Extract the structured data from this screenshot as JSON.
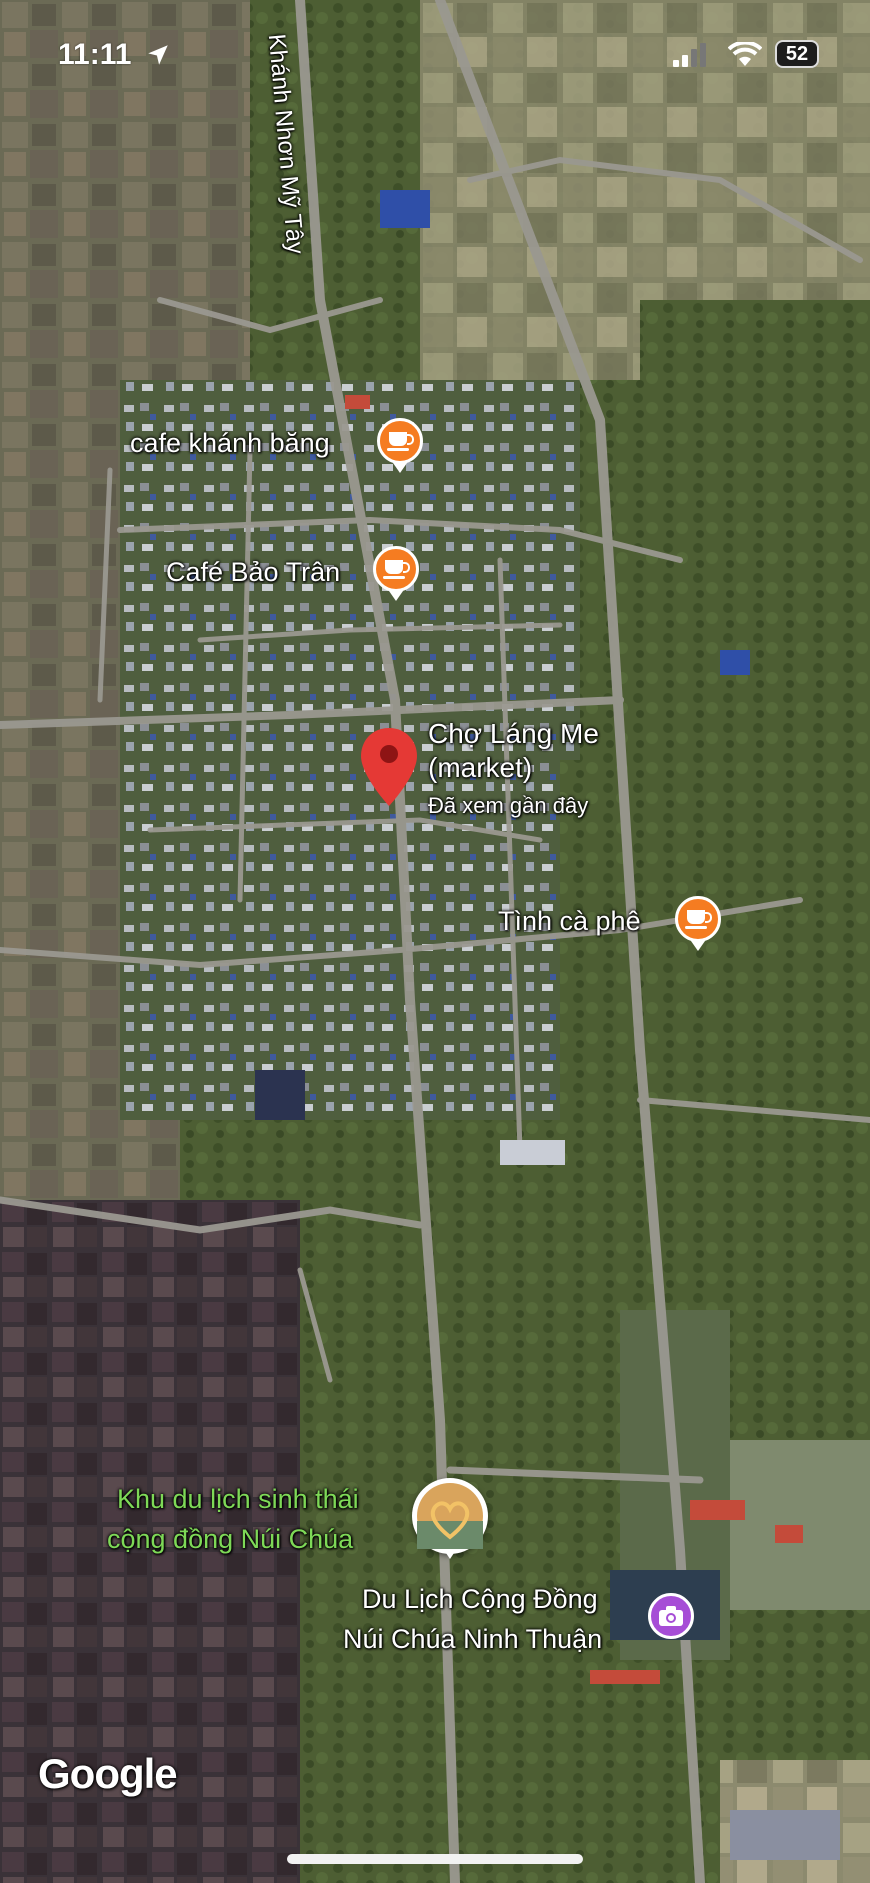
{
  "status_bar": {
    "time": "11:11",
    "battery": "52"
  },
  "map": {
    "road_label": "Khánh Nhơn Mỹ Tây",
    "pois": [
      {
        "name": "cafe khánh băng",
        "type": "cafe"
      },
      {
        "name": "Café Bảo Trân",
        "type": "cafe"
      },
      {
        "name": "Tình cà phê",
        "type": "cafe"
      }
    ],
    "selected_place": {
      "name_line1": "Chợ Láng Me",
      "name_line2": "(market)",
      "subtitle": "Đã xem gần đây"
    },
    "attraction": {
      "name_line1": "Khu du lịch sinh thái",
      "name_line2": "cộng đồng Núi Chúa"
    },
    "photo_spot": {
      "name_line1": "Du Lịch Cộng Đồng",
      "name_line2": "Núi Chúa Ninh Thuận"
    },
    "attribution": "Google"
  },
  "colors": {
    "cafe_pin": "#f57c21",
    "selected_pin": "#e53935",
    "attraction_text": "#7ed957",
    "photo_pin": "#a64dd6"
  }
}
